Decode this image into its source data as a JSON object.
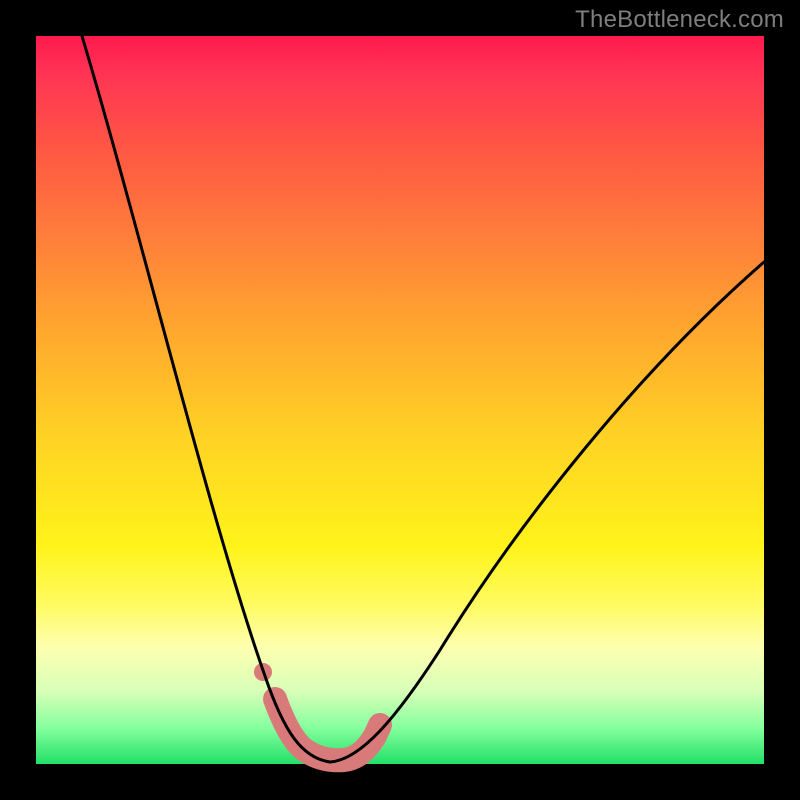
{
  "watermark": "TheBottleneck.com",
  "chart_data": {
    "type": "line",
    "title": "",
    "xlabel": "",
    "ylabel": "",
    "xlim": [
      0,
      100
    ],
    "ylim": [
      0,
      100
    ],
    "series": [
      {
        "name": "bottleneck-curve",
        "x": [
          5,
          10,
          15,
          20,
          25,
          28,
          30,
          32,
          34,
          36,
          38,
          42,
          48,
          55,
          62,
          70,
          80,
          90,
          100
        ],
        "values": [
          100,
          80,
          60,
          42,
          27,
          18,
          12,
          7,
          3,
          1,
          1,
          3,
          9,
          18,
          29,
          41,
          55,
          67,
          76
        ]
      },
      {
        "name": "highlight-band",
        "x": [
          30,
          33,
          36,
          40,
          43
        ],
        "values": [
          6,
          2,
          1,
          2,
          5
        ]
      }
    ],
    "annotations": []
  },
  "colors": {
    "background": "#000000",
    "highlight": "#d97a7a",
    "highlight_dot": "#d97a7a",
    "curve": "#000000"
  }
}
